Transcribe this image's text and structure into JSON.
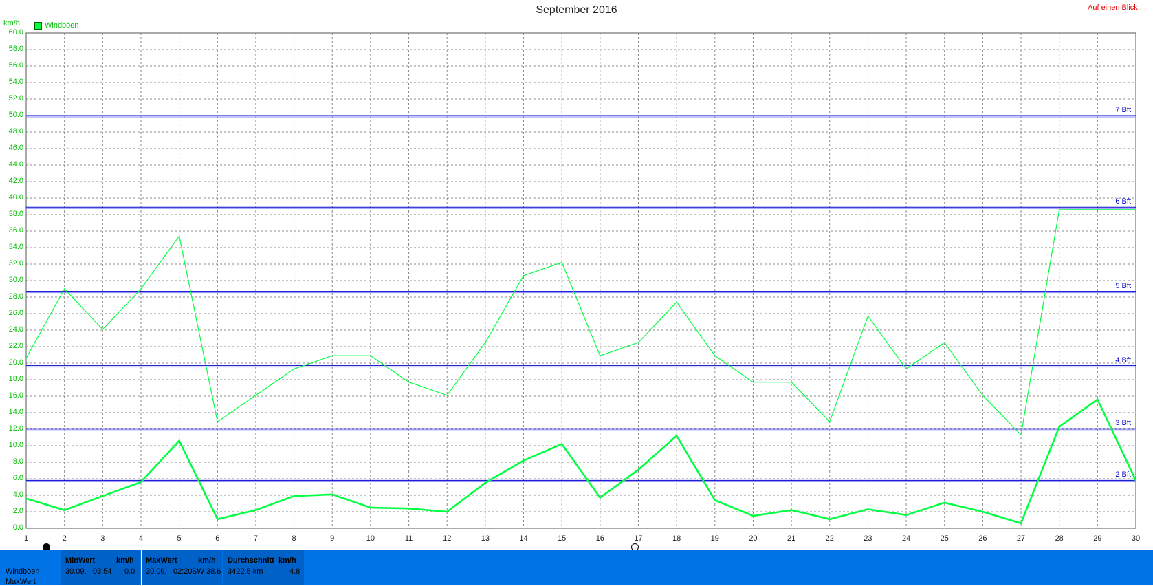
{
  "header": {
    "title": "September 2016",
    "link": "Auf einen Blick ..."
  },
  "legend": {
    "label": "Windböen",
    "color": "#00ff40"
  },
  "colors": {
    "series": "#00ff40",
    "beaufort_line": "#0000cc",
    "axis_text": "#00c000",
    "stats_bg": "#0073e6"
  },
  "chart_data": {
    "type": "line",
    "ylabel": "km/h",
    "ylim": [
      0,
      60
    ],
    "yticks": [
      "0.0",
      "2.0",
      "4.0",
      "6.0",
      "8.0",
      "10.0",
      "12.0",
      "14.0",
      "16.0",
      "18.0",
      "20.0",
      "22.0",
      "24.0",
      "26.0",
      "28.0",
      "30.0",
      "32.0",
      "34.0",
      "36.0",
      "38.0",
      "40.0",
      "42.0",
      "44.0",
      "46.0",
      "48.0",
      "50.0",
      "52.0",
      "54.0",
      "56.0",
      "58.0",
      "60.0"
    ],
    "x": [
      1,
      2,
      3,
      4,
      5,
      6,
      7,
      8,
      9,
      10,
      11,
      12,
      13,
      14,
      15,
      16,
      17,
      18,
      19,
      20,
      21,
      22,
      23,
      24,
      25,
      26,
      27,
      28,
      29,
      30
    ],
    "grid": true,
    "series": [
      {
        "name": "Windböen",
        "values": [
          20.6,
          29.0,
          24.1,
          29.0,
          35.4,
          12.9,
          16.1,
          19.3,
          20.9,
          20.9,
          17.7,
          16.1,
          22.5,
          30.6,
          32.2,
          20.9,
          22.5,
          27.4,
          20.9,
          17.7,
          17.7,
          12.9,
          25.7,
          19.3,
          22.5,
          16.1,
          11.3,
          38.6,
          38.6,
          38.6
        ]
      },
      {
        "name": "",
        "values": [
          3.6,
          2.2,
          3.9,
          5.6,
          10.6,
          1.1,
          2.2,
          3.9,
          4.1,
          2.5,
          2.4,
          2.0,
          5.5,
          8.2,
          10.2,
          3.7,
          7.1,
          11.2,
          3.4,
          1.5,
          2.2,
          1.1,
          2.3,
          1.6,
          3.1,
          2.0,
          0.6,
          12.3,
          15.6,
          5.8
        ]
      }
    ],
    "reference_lines": [
      {
        "label": "2 Bft",
        "value": 5.8
      },
      {
        "label": "3 Bft",
        "value": 12.1
      },
      {
        "label": "4 Bft",
        "value": 19.7
      },
      {
        "label": "5 Bft",
        "value": 28.7
      },
      {
        "label": "6 Bft",
        "value": 38.9
      },
      {
        "label": "7 Bft",
        "value": 50.0
      }
    ]
  },
  "stats": {
    "row_labels": [
      "Windböen",
      "MaxWert"
    ],
    "min": {
      "header": "MinWert",
      "unit": "km/h",
      "date": "30.09.",
      "time": "03:54",
      "value": "0.0"
    },
    "max": {
      "header": "MaxWert",
      "unit": "km/h",
      "date": "30.09.",
      "time": "02:20",
      "dir": "SW",
      "value": "38.6"
    },
    "avg": {
      "header": "Durchschnitt",
      "unit": "km/h",
      "distance": "3422.5 km",
      "value": "4.8"
    }
  }
}
